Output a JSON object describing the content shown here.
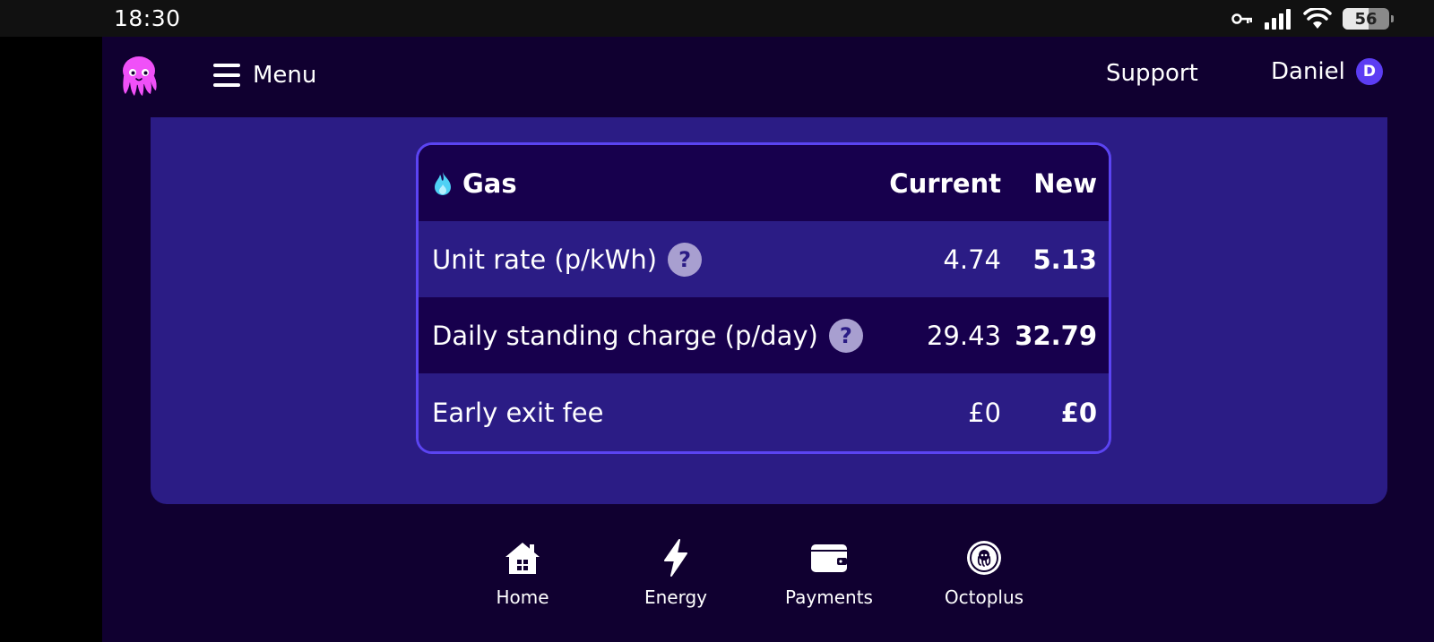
{
  "status_bar": {
    "time": "18:30",
    "battery": "56"
  },
  "header": {
    "menu_label": "Menu",
    "support_label": "Support",
    "user_name": "Daniel",
    "avatar_initial": "D"
  },
  "tariff_table": {
    "fuel_label": "Gas",
    "current_header": "Current",
    "new_header": "New",
    "rows": [
      {
        "label": "Unit rate (p/kWh)",
        "current": "4.74",
        "new": "5.13",
        "has_help": true
      },
      {
        "label": "Daily standing charge (p/day)",
        "current": "29.43",
        "new": "32.79",
        "has_help": true
      },
      {
        "label": "Early exit fee",
        "current": "£0",
        "new": "£0",
        "has_help": false
      }
    ]
  },
  "bottom_nav": {
    "items": [
      {
        "label": "Home",
        "icon": "home-icon"
      },
      {
        "label": "Energy",
        "icon": "lightning-icon"
      },
      {
        "label": "Payments",
        "icon": "wallet-icon"
      },
      {
        "label": "Octoplus",
        "icon": "octoplus-coin-icon"
      }
    ]
  },
  "colors": {
    "background": "#100030",
    "panel": "#2b1c85",
    "accent": "#5b44f2",
    "brand_pink": "#f050f8",
    "gas_flame": "#4fd1f5"
  }
}
